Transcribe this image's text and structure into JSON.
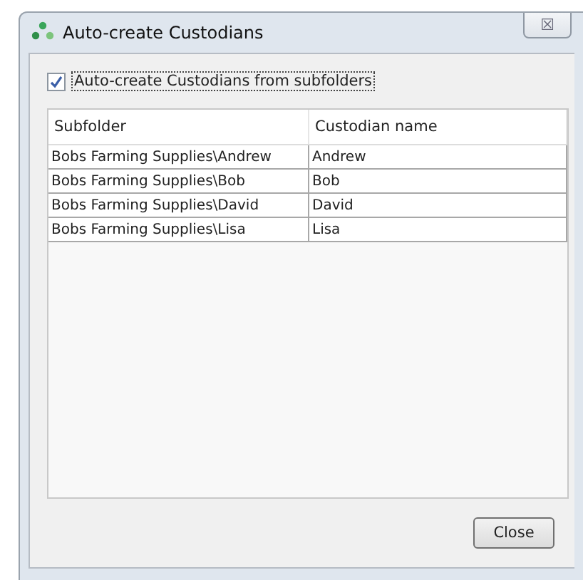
{
  "window": {
    "title": "Auto-create Custodians",
    "close_glyph": "☒"
  },
  "checkbox": {
    "label": "Auto-create Custodians from subfolders",
    "checked": true
  },
  "table": {
    "columns": [
      "Subfolder",
      "Custodian name"
    ],
    "rows": [
      [
        "Bobs Farming Supplies\\Andrew",
        "Andrew"
      ],
      [
        "Bobs Farming Supplies\\Bob",
        "Bob"
      ],
      [
        "Bobs Farming Supplies\\David",
        "David"
      ],
      [
        "Bobs Farming Supplies\\Lisa",
        "Lisa"
      ]
    ]
  },
  "buttons": [
    "Close"
  ]
}
